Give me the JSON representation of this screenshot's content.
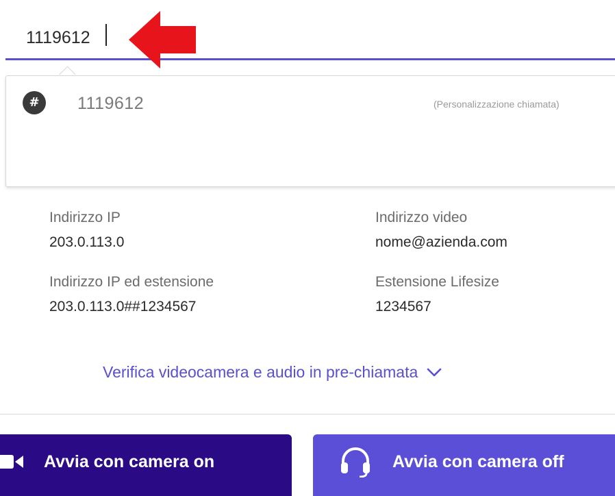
{
  "dial": {
    "value": "1119612"
  },
  "suggestion": {
    "icon": "hash-icon",
    "icon_glyph": "#",
    "number": "1119612",
    "type": "(Personalizzazione chiamata)"
  },
  "info": {
    "ip_label": "Indirizzo IP",
    "ip_value": "203.0.113.0",
    "video_label": "Indirizzo video",
    "video_value": "nome@azienda.com",
    "ip_ext_label": "Indirizzo IP ed estensione",
    "ip_ext_value": "203.0.113.0##1234567",
    "lifesize_label": "Estensione Lifesize",
    "lifesize_value": "1234567"
  },
  "precall": {
    "label": "Verifica videocamera e audio in pre-chiamata",
    "icon": "chevron-down-icon"
  },
  "actions": {
    "camera_on_label": "Avvia con camera on",
    "camera_on_icon": "video-camera-icon",
    "camera_off_label": "Avvia con camera off",
    "camera_off_icon": "headset-icon"
  },
  "colors": {
    "accent": "#5a4fcf",
    "primary_button": "#2b0a86",
    "secondary_button": "#5a4fd6",
    "annotation_arrow": "#e8141b"
  }
}
